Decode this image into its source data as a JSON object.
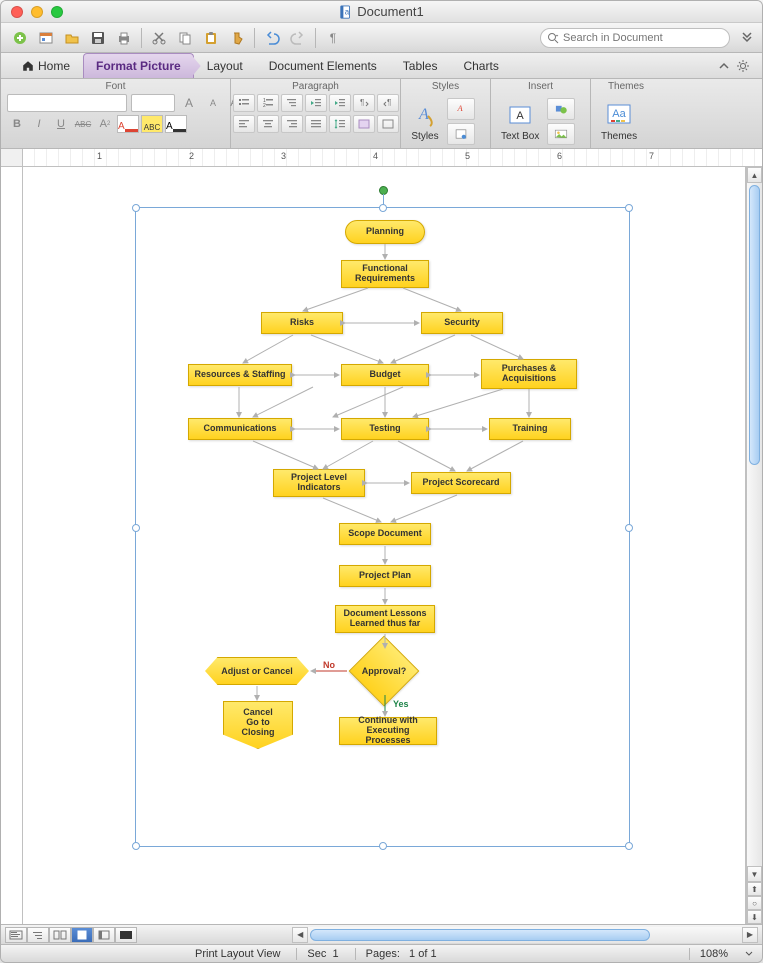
{
  "window": {
    "title": "Document1"
  },
  "search": {
    "placeholder": "Search in Document",
    "dropdown": "Q"
  },
  "tabs": {
    "home": "Home",
    "format_picture": "Format Picture",
    "layout": "Layout",
    "document_elements": "Document Elements",
    "tables": "Tables",
    "charts": "Charts"
  },
  "ribbon_groups": {
    "font": "Font",
    "paragraph": "Paragraph",
    "styles": "Styles",
    "insert": "Insert",
    "themes": "Themes"
  },
  "ribbon_buttons": {
    "bold": "B",
    "italic": "I",
    "underline": "U",
    "strike": "ABC",
    "highlight_letter": "A",
    "fontcolor_letter": "A",
    "highlight_sample": "ABC",
    "styles": "Styles",
    "textbox": "Text Box",
    "themes": "Themes",
    "themes_sample": "Aa"
  },
  "ruler": {
    "n1": "1",
    "n2": "2",
    "n3": "3",
    "n4": "4",
    "n5": "5",
    "n6": "6",
    "n7": "7"
  },
  "flow": {
    "planning": "Planning",
    "functional_requirements": "Functional\nRequirements",
    "risks": "Risks",
    "security": "Security",
    "resources_staffing": "Resources & Staffing",
    "budget": "Budget",
    "purchases": "Purchases &\nAcquisitions",
    "communications": "Communications",
    "testing": "Testing",
    "training": "Training",
    "proj_level_ind": "Project Level\nIndicators",
    "proj_scorecard": "Project Scorecard",
    "scope_doc": "Scope Document",
    "proj_plan": "Project Plan",
    "doc_lessons": "Document Lessons\nLearned thus far",
    "approval": "Approval?",
    "adjust_cancel": "Adjust or Cancel",
    "cancel_closing": "Cancel\nGo to\nClosing",
    "continue": "Continue with\nExecuting Processes",
    "no": "No",
    "yes": "Yes"
  },
  "status": {
    "view_label": "Print Layout View",
    "sec_label": "Sec",
    "sec_value": "1",
    "pages_label": "Pages:",
    "pages_value": "1 of 1",
    "zoom": "108%"
  }
}
